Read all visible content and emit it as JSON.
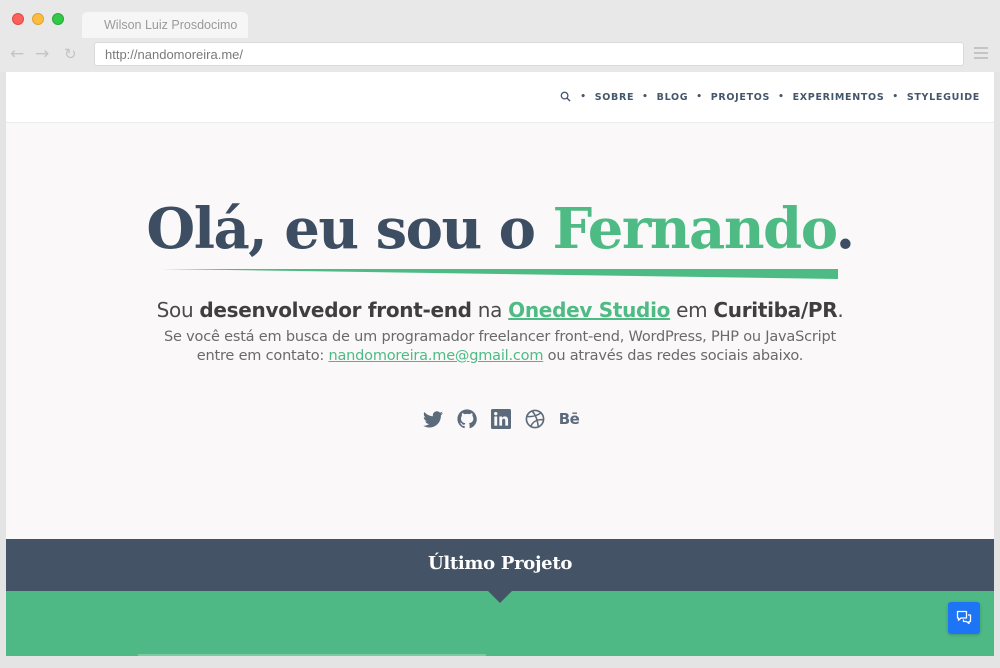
{
  "browser": {
    "tab_title": "Wilson Luiz Prosdocimo",
    "url": "http://nandomoreira.me/",
    "back_icon": "arrow-left-icon",
    "forward_icon": "arrow-right-icon",
    "reload_icon": "reload-icon",
    "menu_icon": "hamburger-icon"
  },
  "nav": {
    "search_icon": "search-icon",
    "items": [
      {
        "label": "SOBRE"
      },
      {
        "label": "BLOG"
      },
      {
        "label": "PROJETOS"
      },
      {
        "label": "EXPERIMENTOS"
      },
      {
        "label": "STYLEGUIDE"
      }
    ]
  },
  "hero": {
    "title_prefix": "Olá, eu sou o ",
    "title_name": "Fernando",
    "title_suffix": ".",
    "sub_1": "Sou ",
    "sub_role": "desenvolvedor front-end",
    "sub_2": " na ",
    "sub_company": "Onedev Studio",
    "sub_3": " em ",
    "sub_city": "Curitiba/PR",
    "sub_4": ".",
    "desc_1": "Se você está em busca de um programador freelancer front-end, WordPress, PHP ou JavaScript",
    "desc_2": "entre em contato: ",
    "email": "nandomoreira.me@gmail.com",
    "desc_3": " ou através das redes sociais abaixo."
  },
  "social": {
    "twitter_icon": "twitter-icon",
    "github_icon": "github-icon",
    "linkedin_icon": "linkedin-icon",
    "dribbble_icon": "dribbble-icon",
    "behance_label": "Bē"
  },
  "latest": {
    "title": "Último Projeto"
  },
  "colors": {
    "accent": "#4ebb85",
    "dark": "#445366",
    "chat": "#1d74f5"
  }
}
